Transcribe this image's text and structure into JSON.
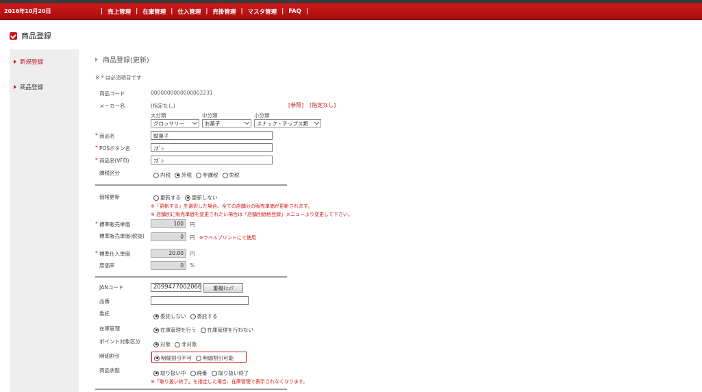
{
  "header": {
    "date": "2016年10月20日",
    "nav": [
      "売上管理",
      "在庫管理",
      "仕入管理",
      "売掛管理",
      "マスタ管理",
      "FAQ"
    ]
  },
  "page_title": "商品登録",
  "sidebar": {
    "items": [
      {
        "label": "新規登録"
      },
      {
        "label": "商品登録"
      }
    ]
  },
  "main": {
    "section_title": "商品登録(更新)",
    "required_note_prefix": "※",
    "required_note_star": "*",
    "required_note_text": "は必須項目です",
    "product_code_label": "商品コード",
    "product_code_value": "0000000000000002231",
    "maker_label": "メーカー名",
    "maker_value": "(指定なし)",
    "maker_ref_link": "[参照]",
    "maker_none_link": "[指定なし]",
    "category": {
      "major_label": "大分類",
      "major_value": "グロッサリー",
      "middle_label": "中分類",
      "middle_value": "お菓子",
      "minor_label": "小分類",
      "minor_value": "スナック・チップス類"
    },
    "product_name_label": "商品名",
    "product_name_value": "駄菓子",
    "pos_button_label": "POSボタン名",
    "pos_button_value": "ﾌｶﾞｼ",
    "vfd_label": "商品名(VFD)",
    "vfd_value": "ﾌｶﾞｼ",
    "tax_label": "課税区分",
    "tax_options": [
      "内税",
      "外税",
      "非課税",
      "免税"
    ],
    "tax_selected": 1,
    "price_update_label": "価格更新",
    "price_update_options": [
      "更新する",
      "更新しない"
    ],
    "price_update_selected": 1,
    "price_update_note1": "※「更新する」を選択した場合、全ての店舗分の販売単価が更新されます。",
    "price_update_note2": "※ 店舗別に販売単価を変更されたい場合は「店舗別価格登録」メニューより変更して下さい。",
    "std_sale_label": "標準販売単価",
    "std_sale_value": "100",
    "std_sale_taxfree_label": "標準販売単価(税抜)",
    "std_sale_taxfree_value": "0",
    "label_print_note": "※ラベルプリントにて使用",
    "std_purchase_label": "標準仕入単価",
    "std_purchase_value": "20.00",
    "cost_rate_label": "原価率",
    "cost_rate_value": "0",
    "unit_yen": "円",
    "unit_percent": "%",
    "jan_label": "JANコード",
    "jan_value": "2099477002066",
    "dup_check_button": "重複ﾁｪｯｸ",
    "part_no_label": "品番",
    "part_no_value": "",
    "consign_label": "委託",
    "consign_options": [
      "委託しない",
      "委託する"
    ],
    "consign_selected": 0,
    "stock_label": "在庫管理",
    "stock_options": [
      "在庫管理を行う",
      "在庫管理を行わない"
    ],
    "stock_selected": 0,
    "point_label": "ポイント対象区分",
    "point_options": [
      "対象",
      "非対象"
    ],
    "point_selected": 0,
    "discount_label": "明細割引",
    "discount_options": [
      "明細割引不可",
      "明細割引可能"
    ],
    "discount_selected": 0,
    "status_label": "商品状態",
    "status_options": [
      "取り扱い中",
      "廃番",
      "取り扱い終了"
    ],
    "status_selected": 0,
    "status_note": "※「取り扱い終了」を指定した場合、在庫管理で表示されなくなります。"
  }
}
